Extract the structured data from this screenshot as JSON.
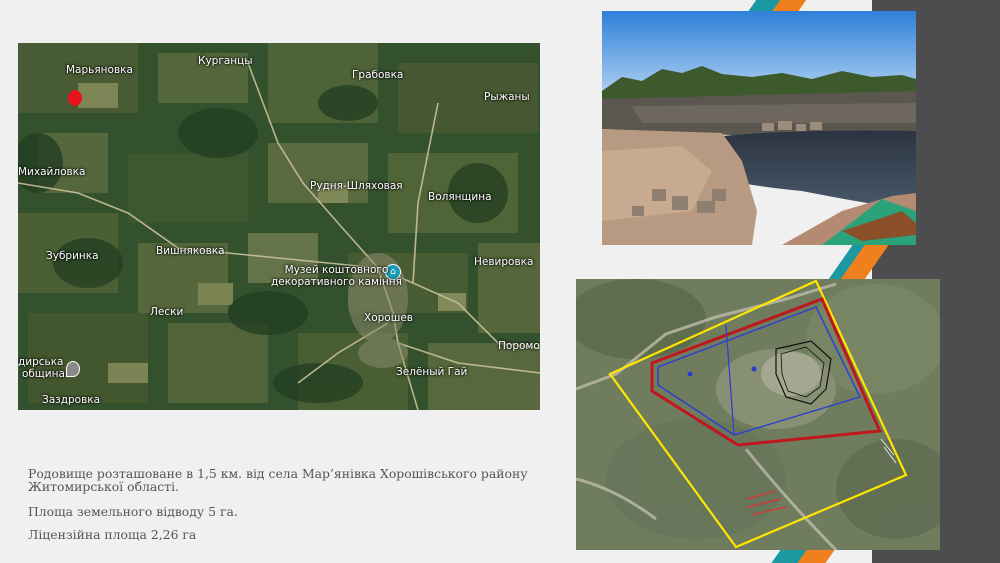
{
  "map": {
    "labels": [
      {
        "id": "maryanovka",
        "text": "Марьяновка"
      },
      {
        "id": "kurgantsy",
        "text": "Курганцы"
      },
      {
        "id": "grabovka",
        "text": "Грабовка"
      },
      {
        "id": "ryzhany",
        "text": "Рыжаны"
      },
      {
        "id": "mikhailovka",
        "text": "Михайловка"
      },
      {
        "id": "rudnya",
        "text": "Рудня-Шляховая"
      },
      {
        "id": "volyanshchina",
        "text": "Волянщина"
      },
      {
        "id": "zubrinka",
        "text": "Зубринка"
      },
      {
        "id": "vishnyakovka",
        "text": "Вишняковка"
      },
      {
        "id": "nevirovka",
        "text": "Невировка"
      },
      {
        "id": "leski",
        "text": "Лески"
      },
      {
        "id": "khoroshev",
        "text": "Хорошев"
      },
      {
        "id": "poromov",
        "text": "Поромо"
      },
      {
        "id": "hromada",
        "text": "дирська"
      },
      {
        "id": "hromada2",
        "text": "община"
      },
      {
        "id": "zelenyi",
        "text": "Зелёный Гай"
      },
      {
        "id": "zazdrovka",
        "text": "Заздровка"
      }
    ],
    "museum_line1": "Музей коштовного",
    "museum_line2": "декоративного каміння",
    "marker_color": "#e8121b"
  },
  "text": {
    "p1": "Родовище розташоване в 1,5 км. від села Мар’янівка Хорошівського району Житомирської області.",
    "p2": "Площа земельного відводу 5 га.",
    "p3": "Ліцензійна площа 2,26 га"
  },
  "colors": {
    "accent_orange": "#f07f1e",
    "accent_teal": "#1a9aa0",
    "band_dark": "#4d4d4f",
    "boundary_yellow": "#ffe600",
    "boundary_red": "#c0161d",
    "boundary_blue": "#2a3cd6"
  }
}
